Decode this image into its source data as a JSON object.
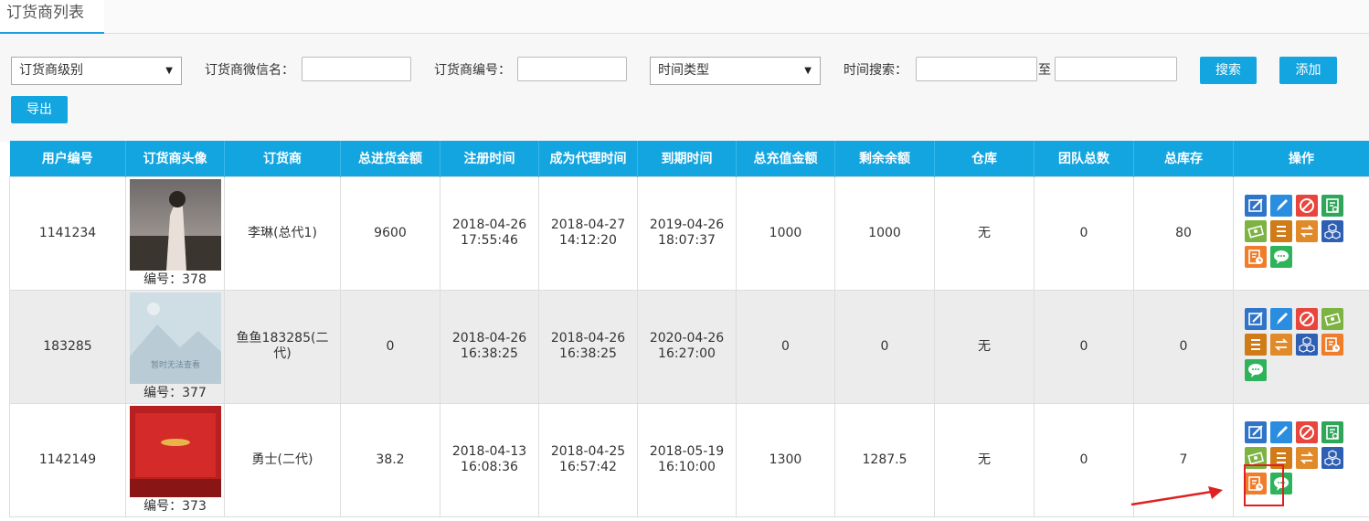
{
  "tab": {
    "title": "订货商列表"
  },
  "filters": {
    "level_select": "订货商级别",
    "wechat_label": "订货商微信名：",
    "number_label": "订货商编号：",
    "time_type_select": "时间类型",
    "time_search_label": "时间搜索：",
    "to_label": "至",
    "search_button": "搜索",
    "add_button": "添加",
    "export_button": "导出"
  },
  "table": {
    "headers": [
      "用户编号",
      "订货商头像",
      "订货商",
      "总进货金额",
      "注册时间",
      "成为代理时间",
      "到期时间",
      "总充值金额",
      "剩余余额",
      "仓库",
      "团队总数",
      "总库存",
      "操作"
    ],
    "rows": [
      {
        "user_id": "1141234",
        "avatar_num": "编号：378",
        "name": "李琳(总代1)",
        "total_purchase": "9600",
        "reg_time": "2018-04-26 17:55:46",
        "agent_time": "2018-04-27 14:12:20",
        "expire_time": "2019-04-26 18:07:37",
        "total_recharge": "1000",
        "balance": "1000",
        "warehouse": "无",
        "team": "0",
        "stock": "80"
      },
      {
        "user_id": "183285",
        "avatar_num": "编号：377",
        "avatar_placeholder": "暂时无法查看",
        "name": "鱼鱼183285(二代)",
        "total_purchase": "0",
        "reg_time": "2018-04-26 16:38:25",
        "agent_time": "2018-04-26 16:38:25",
        "expire_time": "2020-04-26 16:27:00",
        "total_recharge": "0",
        "balance": "0",
        "warehouse": "无",
        "team": "0",
        "stock": "0"
      },
      {
        "user_id": "1142149",
        "avatar_num": "编号：373",
        "name": "勇士(二代)",
        "total_purchase": "38.2",
        "reg_time": "2018-04-13 16:08:36",
        "agent_time": "2018-04-25 16:57:42",
        "expire_time": "2018-05-19 16:10:00",
        "total_recharge": "1300",
        "balance": "1287.5",
        "warehouse": "无",
        "team": "0",
        "stock": "7"
      }
    ]
  },
  "colors": {
    "accent": "#12a5e0",
    "highlight": "#e02020"
  }
}
